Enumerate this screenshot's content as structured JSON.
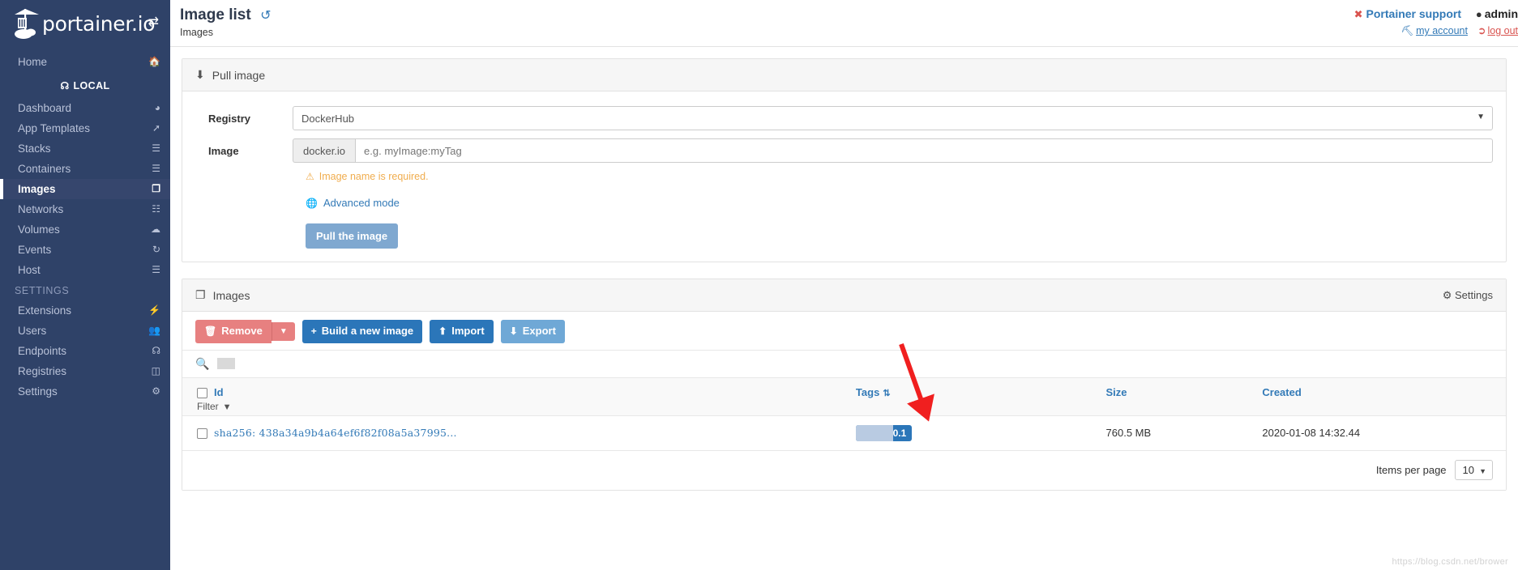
{
  "brand": {
    "name": "portainer.io",
    "logo_icon": "portainer-crane-logo",
    "toggle_icon": "sidebar-toggle-icon"
  },
  "sidebar": {
    "home": {
      "label": "Home",
      "icon": "home-icon"
    },
    "endpoint_section": {
      "label": "LOCAL",
      "icon": "plug-icon"
    },
    "items": [
      {
        "label": "Dashboard",
        "icon": "dashboard-icon",
        "active": false
      },
      {
        "label": "App Templates",
        "icon": "rocket-icon",
        "active": false
      },
      {
        "label": "Stacks",
        "icon": "stacks-icon",
        "active": false
      },
      {
        "label": "Containers",
        "icon": "containers-icon",
        "active": false
      },
      {
        "label": "Images",
        "icon": "images-icon",
        "active": true
      },
      {
        "label": "Networks",
        "icon": "networks-icon",
        "active": false
      },
      {
        "label": "Volumes",
        "icon": "volumes-icon",
        "active": false
      },
      {
        "label": "Events",
        "icon": "events-clock-icon",
        "active": false
      },
      {
        "label": "Host",
        "icon": "host-icon",
        "active": false
      }
    ],
    "settings_section": {
      "label": "SETTINGS"
    },
    "settings_items": [
      {
        "label": "Extensions",
        "icon": "bolt-icon"
      },
      {
        "label": "Users",
        "icon": "users-icon"
      },
      {
        "label": "Endpoints",
        "icon": "plug-icon"
      },
      {
        "label": "Registries",
        "icon": "registries-icon"
      },
      {
        "label": "Settings",
        "icon": "gear-icon"
      }
    ]
  },
  "header": {
    "title": "Image list",
    "refresh_icon": "refresh-icon",
    "breadcrumb": "Images",
    "support_label": "Portainer support",
    "support_icon": "lifebuoy-icon",
    "user_name": "admin",
    "user_icon": "user-circle-icon",
    "my_account_label": "my account",
    "my_account_icon": "wrench-icon",
    "logout_label": "log out",
    "logout_icon": "logout-icon"
  },
  "pull_panel": {
    "title": "Pull image",
    "title_icon": "download-icon",
    "registry_label": "Registry",
    "registry_value": "DockerHub",
    "image_label": "Image",
    "image_addon": "docker.io",
    "image_placeholder": "e.g. myImage:myTag",
    "image_value": "",
    "error_message": "Image name is required.",
    "error_icon": "warning-triangle-icon",
    "advanced_label": "Advanced mode",
    "advanced_icon": "globe-icon",
    "pull_button": "Pull the image"
  },
  "images_panel": {
    "title": "Images",
    "title_icon": "images-icon",
    "settings_label": "Settings",
    "settings_icon": "gear-icon",
    "buttons": {
      "remove": "Remove",
      "remove_icon": "trash-icon",
      "remove_caret_icon": "caret-down-icon",
      "build": "Build a new image",
      "build_icon": "plus-icon",
      "import": "Import",
      "import_icon": "upload-icon",
      "export": "Export",
      "export_icon": "download-icon"
    },
    "search": {
      "icon": "search-icon",
      "value": "",
      "placeholder": ""
    },
    "table": {
      "columns": [
        {
          "label": "Id",
          "sort_icon": ""
        },
        {
          "label": "Tags",
          "sort_icon": "sort-icon"
        },
        {
          "label": "Size",
          "sort_icon": ""
        },
        {
          "label": "Created",
          "sort_icon": ""
        }
      ],
      "filter_label": "Filter",
      "filter_icon": "filter-icon",
      "rows": [
        {
          "id": "sha256: 438a34a9b4a64ef6f82f08a5a37995...",
          "tag": "/test:0.0.1",
          "size": "760.5 MB",
          "created": "2020-01-08 14:32.44"
        }
      ]
    },
    "footer": {
      "items_per_page_label": "Items per page",
      "items_per_page_value": "10",
      "caret_icon": "caret-down-icon"
    }
  },
  "annotation": {
    "arrow_icon": "red-arrow-annotation",
    "arrow_color": "#f01f1f"
  },
  "watermark": "https://blog.csdn.net/brower",
  "colors": {
    "sidebar_bg": "#2f4268",
    "accent_blue": "#337ab7",
    "primary_button": "#2b76b9",
    "danger": "#e78080",
    "warning": "#f0ad4e"
  }
}
